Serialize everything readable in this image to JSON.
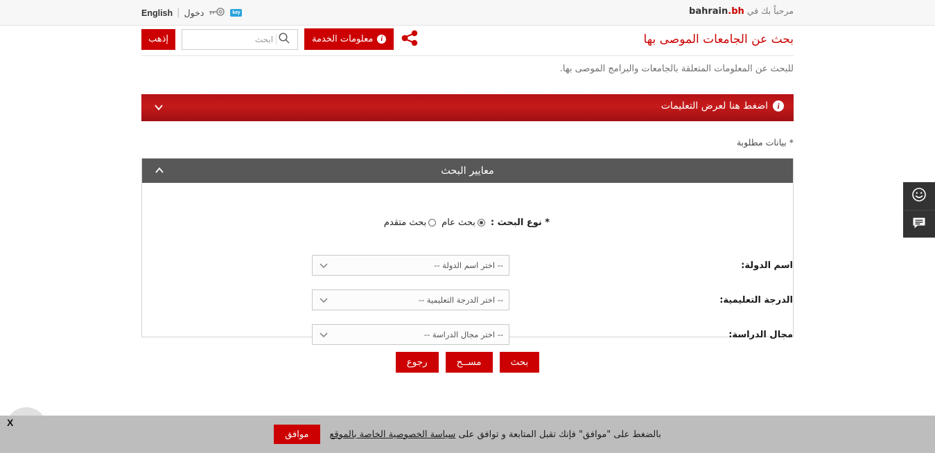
{
  "topbar": {
    "welcome_prefix": "مرحباً بك في",
    "brand_dark": "bahrain",
    "brand_red": ".bh",
    "language_link": "English",
    "separator": "|",
    "login_label": "دخول",
    "key_badge": "key",
    "key_icon": "key-icon"
  },
  "header": {
    "page_title": "بحث عن الجامعات الموصى بها",
    "subtitle": "للبحث عن المعلومات المتعلقة بالجامعات والبرامج الموصى بها.",
    "go_button": "إذهب",
    "search_placeholder": "ابحث",
    "search_value": "",
    "search_icon": "search-icon",
    "service_info_button": "معلومات الخدمة",
    "service_info_icon": "info-icon",
    "share_icon": "share-icon"
  },
  "instructions": {
    "label": "اضغط هنا لعرض التعليمات",
    "info_icon": "info-icon",
    "chevron_icon": "chevron-down-icon"
  },
  "required_note": "* بيانات مطلوبة",
  "panel": {
    "title": "معايير البحث",
    "collapse_icon": "chevron-up-icon",
    "search_type": {
      "label": "* نوع البحث :",
      "options": [
        {
          "label": "بحث عام",
          "selected": true
        },
        {
          "label": "بحث متقدم",
          "selected": false
        }
      ]
    },
    "fields": [
      {
        "label": "اسم الدولة:",
        "value": "-- اختر اسم الدولة --",
        "arrow_icon": "chevron-down-icon"
      },
      {
        "label": "الدرجة التعليمية:",
        "value": "-- اختر الدرجة التعليمية --",
        "arrow_icon": "chevron-down-icon"
      },
      {
        "label": "مجال الدراسة:",
        "value": "-- اختر مجال الدراسة --",
        "arrow_icon": "chevron-down-icon"
      }
    ]
  },
  "actions": {
    "search": "بحث",
    "clear": "مســح",
    "back": "رجوع"
  },
  "side_widgets": [
    {
      "name": "feedback-smiley-icon"
    },
    {
      "name": "chat-bubble-icon"
    }
  ],
  "cookie_bar": {
    "text_before": "بالضغط على \"موافق\" فإنك تقبل المتابعة و توافق على",
    "link_text": "سياسة الخصوصية الخاصة بالموقع",
    "agree_button": "موافق",
    "close_label": "X"
  },
  "colors": {
    "brand_red": "#cc0000",
    "banner_red": "#b51218",
    "panel_gray": "#585858",
    "cookie_gray": "#bdbdbd",
    "widget_dark": "#333333"
  }
}
